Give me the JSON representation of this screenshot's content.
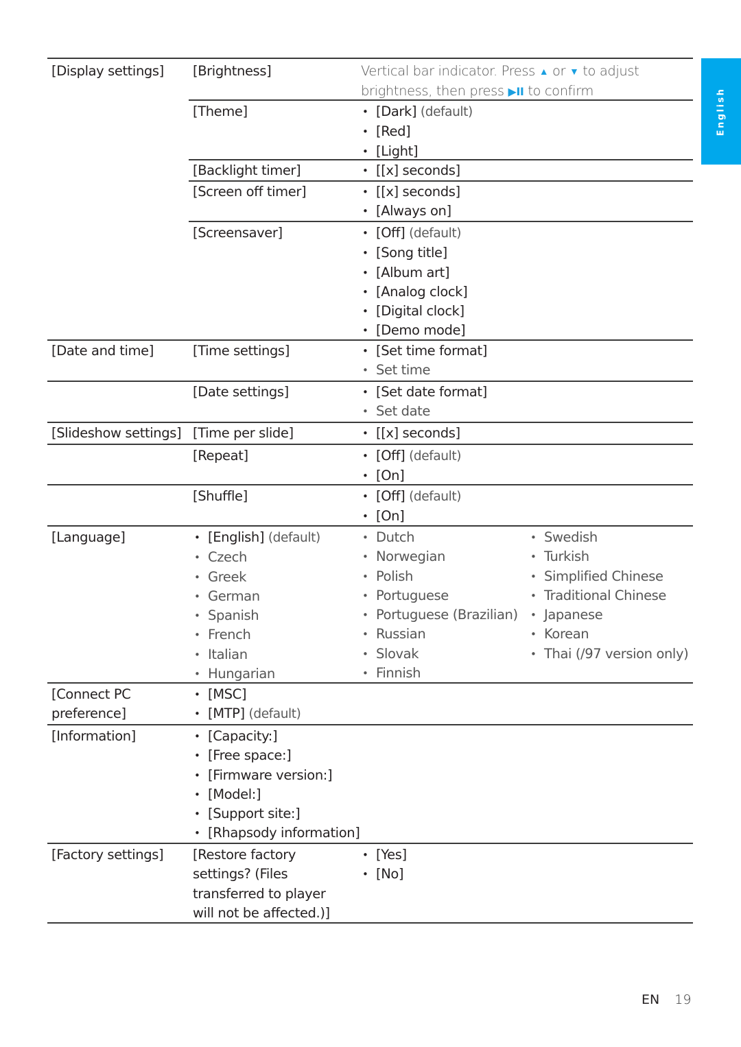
{
  "side_tab": {
    "label": "English",
    "color": "#00a8ec"
  },
  "display_settings": {
    "label": "[Display settings]",
    "brightness": {
      "label": "[Brightness]",
      "desc_1": "Vertical bar indicator. Press",
      "up_icon": "▲",
      "or": "or",
      "down_icon": "▼",
      "desc_2": "to adjust",
      "desc_3": "brightness, then press",
      "play_pause_icon": "▶II",
      "desc_4": "to confirm"
    },
    "theme": {
      "label": "[Theme]",
      "options": [
        "[Dark]",
        "[Red]",
        "[Light]"
      ],
      "default_suffix": "(default)"
    },
    "backlight_timer": {
      "label": "[Backlight timer]",
      "options": [
        "[[x] seconds]"
      ]
    },
    "screen_off_timer": {
      "label": "[Screen off timer]",
      "options": [
        "[[x] seconds]",
        "[Always on]"
      ]
    },
    "screensaver": {
      "label": "[Screensaver]",
      "options": [
        "[Off]",
        "[Song title]",
        "[Album art]",
        "[Analog clock]",
        "[Digital clock]",
        "[Demo mode]"
      ],
      "default_suffix": "(default)"
    }
  },
  "date_and_time": {
    "label": "[Date and time]",
    "time_settings": {
      "label": "[Time settings]",
      "options": [
        "[Set time format]",
        "Set time"
      ]
    },
    "date_settings": {
      "label": "[Date settings]",
      "options": [
        "[Set date format]",
        "Set date"
      ]
    }
  },
  "slideshow_settings": {
    "label": "[Slideshow settings]",
    "time_per_slide": {
      "label": "[Time per slide]",
      "options": [
        "[[x] seconds]"
      ]
    },
    "repeat": {
      "label": "[Repeat]",
      "options": [
        "[Off]",
        "[On]"
      ],
      "default_suffix": "(default)"
    },
    "shuffle": {
      "label": "[Shuffle]",
      "options": [
        "[Off]",
        "[On]"
      ],
      "default_suffix": "(default)"
    }
  },
  "language": {
    "label": "[Language]",
    "default_suffix": "(default)",
    "col1": [
      "[English]",
      "Czech",
      "Greek",
      "German",
      "Spanish",
      "French",
      "Italian",
      "Hungarian"
    ],
    "col2": [
      "Dutch",
      "Norwegian",
      "Polish",
      "Portuguese",
      "Portuguese (Brazilian)",
      "Russian",
      "Slovak",
      "Finnish"
    ],
    "col3": [
      "Swedish",
      "Turkish",
      "Simplified Chinese",
      "Traditional Chinese",
      "Japanese",
      "Korean",
      "Thai (/97 version only)"
    ]
  },
  "connect_pc": {
    "label_1": "[Connect PC",
    "label_2": "preference]",
    "options": [
      "[MSC]",
      "[MTP]"
    ],
    "default_suffix": "(default)"
  },
  "information": {
    "label": "[Information]",
    "options": [
      "[Capacity:]",
      "[Free space:]",
      "[Firmware version:]",
      "[Model:]",
      "[Support site:]",
      "[Rhapsody information]"
    ]
  },
  "factory_settings": {
    "label": "[Factory settings]",
    "prompt": [
      "[Restore factory",
      "settings? (Files",
      "transferred to player",
      "will not be affected.)]"
    ],
    "options": [
      "[Yes]",
      "[No]"
    ]
  },
  "footer": {
    "lang": "EN",
    "page": "19"
  }
}
